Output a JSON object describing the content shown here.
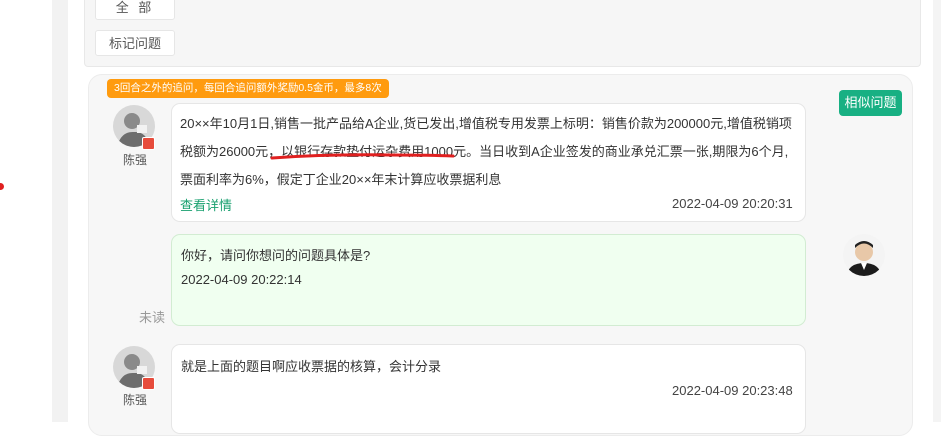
{
  "filters": {
    "all_label": "全 部",
    "marked_label": "标记问题"
  },
  "notice": "3回合之外的追问，每回合追问额外奖励0.5金币，最多8次",
  "similar_button": "相似问题",
  "messages": [
    {
      "user": "陈强",
      "text_part1": "20××年10月1日,销售一批产品给A企业,货已发出,增值税专用发票上标明：销售价款为200000元,增值税销项税额为26000元，",
      "text_highlight": "以银行存款垫付运杂费用1000元",
      "text_part2": "。当日收到A企业签发的商业承兑汇票一张,期限为6个月,票面利率为6%，假定丁企业20××年末计算应收票据利息",
      "link": "查看详情",
      "time": "2022-04-09 20:20:31"
    },
    {
      "text": "你好，请问你想问的问题具体是?",
      "time": "2022-04-09 20:22:14",
      "status": "未读"
    },
    {
      "user": "陈强",
      "text": "就是上面的题目啊应收票据的核算，会计分录",
      "time": "2022-04-09 20:23:48"
    }
  ],
  "colors": {
    "accent": "#18b083",
    "notice": "#ff9b0f",
    "underline": "#e02020"
  }
}
